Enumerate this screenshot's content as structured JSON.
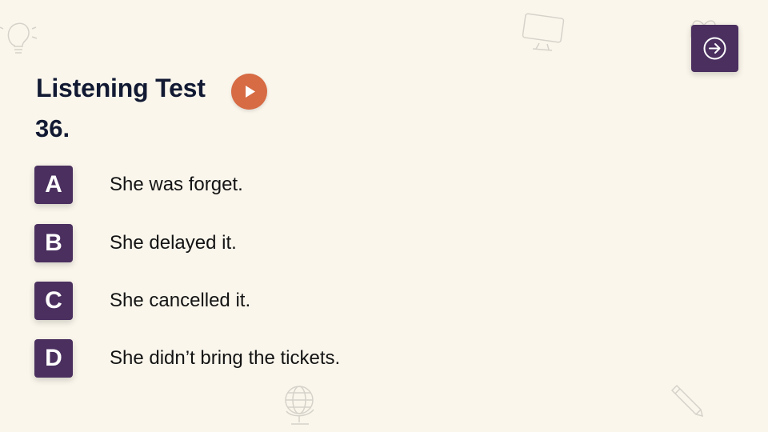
{
  "header": {
    "title": "Listening Test",
    "question_number": "36.",
    "play_icon": "play-icon",
    "next_icon": "arrow-right-circle-icon"
  },
  "options": [
    {
      "letter": "A",
      "text": "She was forget."
    },
    {
      "letter": "B",
      "text": "She delayed it."
    },
    {
      "letter": "C",
      "text": "She cancelled it."
    },
    {
      "letter": "D",
      "text": "She didn’t bring the tickets."
    }
  ],
  "colors": {
    "background": "#faf6ec",
    "accent_purple": "#4a2f5f",
    "play_orange": "#d66b44",
    "heading": "#121a33"
  },
  "doodles": [
    "lightbulb-icon",
    "monitor-icon",
    "gift-icon",
    "globe-icon",
    "pencil-icon"
  ]
}
